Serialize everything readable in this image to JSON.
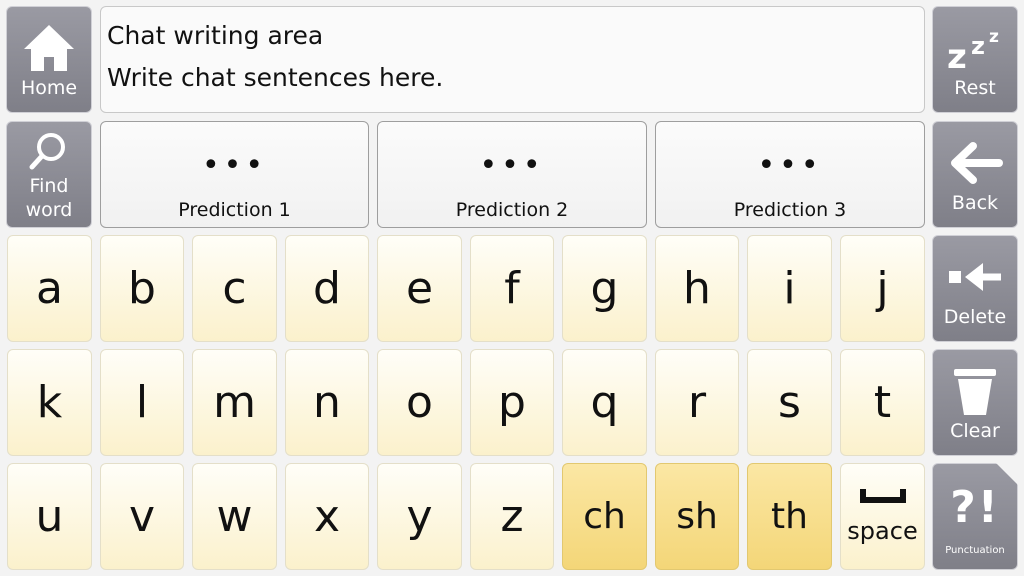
{
  "side_left": {
    "home": {
      "label": "Home",
      "icon": "home-icon"
    },
    "find_word": {
      "label_line1": "Find",
      "label_line2": "word",
      "icon": "search-icon"
    }
  },
  "message_window": {
    "line1": "Chat writing area",
    "line2": "Write chat sentences here."
  },
  "predictions": [
    {
      "dots": "•••",
      "label": "Prediction 1"
    },
    {
      "dots": "•••",
      "label": "Prediction 2"
    },
    {
      "dots": "•••",
      "label": "Prediction 3"
    }
  ],
  "side_right": {
    "rest": {
      "label": "Rest",
      "icon": "zzz-icon",
      "glyph": "z"
    },
    "back": {
      "label": "Back",
      "icon": "arrow-left-icon"
    },
    "delete": {
      "label": "Delete",
      "icon": "delete-icon"
    },
    "clear": {
      "label": "Clear",
      "icon": "trash-icon"
    },
    "punctuation": {
      "label": "Punctuation",
      "icon": "punctuation-icon",
      "glyph": "?!"
    }
  },
  "keys": {
    "row1": [
      "a",
      "b",
      "c",
      "d",
      "e",
      "f",
      "g",
      "h",
      "i",
      "j"
    ],
    "row2": [
      "k",
      "l",
      "m",
      "n",
      "o",
      "p",
      "q",
      "r",
      "s",
      "t"
    ],
    "row3": [
      "u",
      "v",
      "w",
      "x",
      "y",
      "z"
    ],
    "digraphs": [
      "ch",
      "sh",
      "th"
    ],
    "space": "space"
  },
  "colors": {
    "side_button": "#8c8c95",
    "letter_key": "#fdf6dc",
    "digraph_key": "#f6db82"
  }
}
